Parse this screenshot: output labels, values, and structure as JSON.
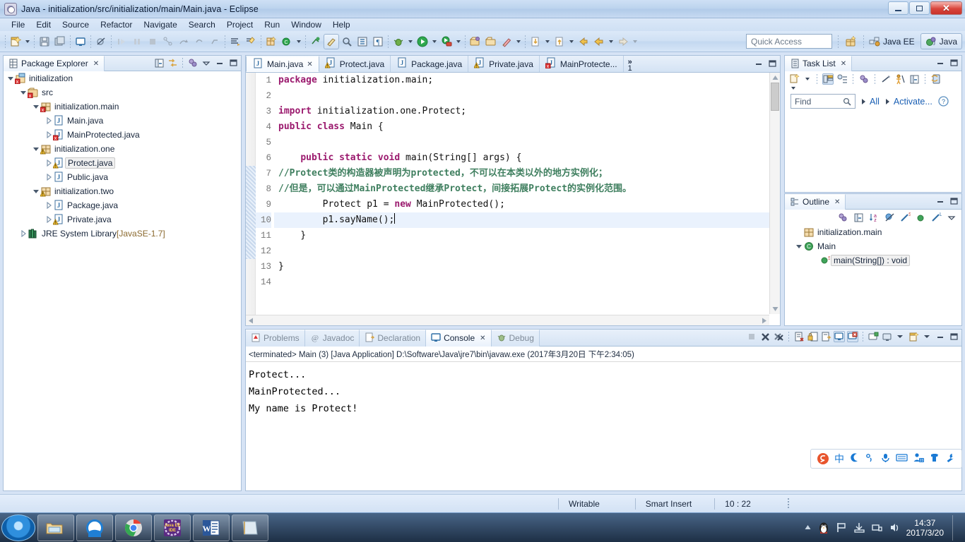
{
  "window": {
    "title": "Java - initialization/src/initialization/main/Main.java - Eclipse",
    "app_icon": "eclipse-icon",
    "minimize": "minimize-button",
    "maximize": "maximize-button",
    "close": "close-button"
  },
  "menubar": [
    "File",
    "Edit",
    "Source",
    "Refactor",
    "Navigate",
    "Search",
    "Project",
    "Run",
    "Window",
    "Help"
  ],
  "toolbar": {
    "quick_access_placeholder": "Quick Access",
    "perspectives": [
      {
        "label": "Java EE",
        "active": false
      },
      {
        "label": "Java",
        "active": true
      }
    ]
  },
  "package_explorer": {
    "title": "Package Explorer",
    "tree": [
      {
        "label": "initialization",
        "indent": 0,
        "arrow": "open",
        "icon": "project-icon",
        "error": true,
        "warn": false,
        "selected": false
      },
      {
        "label": "src",
        "indent": 1,
        "arrow": "open",
        "icon": "source-folder-icon",
        "error": true,
        "warn": false,
        "selected": false
      },
      {
        "label": "initialization.main",
        "indent": 2,
        "arrow": "open",
        "icon": "package-icon",
        "error": true,
        "warn": false,
        "selected": false
      },
      {
        "label": "Main.java",
        "indent": 3,
        "arrow": "closed",
        "icon": "java-file-icon",
        "error": false,
        "warn": false,
        "selected": false
      },
      {
        "label": "MainProtected.java",
        "indent": 3,
        "arrow": "closed",
        "icon": "java-file-icon",
        "error": true,
        "warn": false,
        "selected": false
      },
      {
        "label": "initialization.one",
        "indent": 2,
        "arrow": "open",
        "icon": "package-icon",
        "error": false,
        "warn": true,
        "selected": false
      },
      {
        "label": "Protect.java",
        "indent": 3,
        "arrow": "closed",
        "icon": "java-file-icon",
        "error": false,
        "warn": true,
        "selected": true
      },
      {
        "label": "Public.java",
        "indent": 3,
        "arrow": "closed",
        "icon": "java-file-icon",
        "error": false,
        "warn": false,
        "selected": false
      },
      {
        "label": "initialization.two",
        "indent": 2,
        "arrow": "open",
        "icon": "package-icon",
        "error": false,
        "warn": true,
        "selected": false
      },
      {
        "label": "Package.java",
        "indent": 3,
        "arrow": "closed",
        "icon": "java-file-icon",
        "error": false,
        "warn": false,
        "selected": false
      },
      {
        "label": "Private.java",
        "indent": 3,
        "arrow": "closed",
        "icon": "java-file-icon",
        "error": false,
        "warn": true,
        "selected": false
      },
      {
        "label": "JRE System Library",
        "suffix": " [JavaSE-1.7]",
        "indent": 1,
        "arrow": "closed",
        "icon": "jre-library-icon",
        "error": false,
        "warn": false,
        "selected": false
      }
    ]
  },
  "editor": {
    "tabs": [
      {
        "label": "Main.java",
        "icon": "java-file-icon",
        "active": true,
        "closeable": true,
        "warn": false,
        "error": false
      },
      {
        "label": "Protect.java",
        "icon": "java-file-icon",
        "active": false,
        "closeable": false,
        "warn": true,
        "error": false
      },
      {
        "label": "Package.java",
        "icon": "java-file-icon",
        "active": false,
        "closeable": false,
        "warn": false,
        "error": false
      },
      {
        "label": "Private.java",
        "icon": "java-file-icon",
        "active": false,
        "closeable": false,
        "warn": true,
        "error": false
      },
      {
        "label": "MainProtecte...",
        "icon": "java-file-icon",
        "active": false,
        "closeable": false,
        "warn": false,
        "error": true
      }
    ],
    "overflow_chevron": "»",
    "overflow_count": "1",
    "line_numbers": [
      "1",
      "2",
      "3",
      "4",
      "5",
      "6",
      "7",
      "8",
      "9",
      "10",
      "11",
      "12",
      "13",
      "14"
    ],
    "lines": [
      {
        "n": 1,
        "segs": [
          {
            "t": "package ",
            "c": "kw"
          },
          {
            "t": "initialization.main;",
            "c": "pl"
          }
        ]
      },
      {
        "n": 2,
        "segs": []
      },
      {
        "n": 3,
        "segs": [
          {
            "t": "import ",
            "c": "kw"
          },
          {
            "t": "initialization.one.Protect;",
            "c": "pl"
          }
        ]
      },
      {
        "n": 4,
        "segs": [
          {
            "t": "public class ",
            "c": "kw"
          },
          {
            "t": "Main {",
            "c": "pl"
          }
        ]
      },
      {
        "n": 5,
        "segs": []
      },
      {
        "n": 6,
        "segs": [
          {
            "t": "    ",
            "c": "pl"
          },
          {
            "t": "public static void ",
            "c": "kw"
          },
          {
            "t": "main(String[] args) {",
            "c": "pl"
          }
        ],
        "fold": true
      },
      {
        "n": 7,
        "segs": [
          {
            "t": "//Protect类的构造器被声明为protected，不可以在本类以外的地方实例化；",
            "c": "cm"
          }
        ]
      },
      {
        "n": 8,
        "segs": [
          {
            "t": "//但是，可以通过MainProtected继承Protect，间接拓展Protect的实例化范围。",
            "c": "cm"
          }
        ]
      },
      {
        "n": 9,
        "segs": [
          {
            "t": "        Protect p1 = ",
            "c": "pl"
          },
          {
            "t": "new ",
            "c": "kw"
          },
          {
            "t": "MainProtected();",
            "c": "pl"
          }
        ]
      },
      {
        "n": 10,
        "segs": [
          {
            "t": "        p1.sayName();",
            "c": "pl"
          }
        ],
        "highlight": true,
        "caret": true
      },
      {
        "n": 11,
        "segs": [
          {
            "t": "    }",
            "c": "pl"
          }
        ]
      },
      {
        "n": 12,
        "segs": []
      },
      {
        "n": 13,
        "segs": [
          {
            "t": "}",
            "c": "pl"
          }
        ]
      },
      {
        "n": 14,
        "segs": []
      }
    ]
  },
  "bottom_panel": {
    "tabs": [
      {
        "label": "Problems",
        "icon": "problems-icon",
        "active": false
      },
      {
        "label": "Javadoc",
        "icon": "javadoc-icon",
        "active": false
      },
      {
        "label": "Declaration",
        "icon": "declaration-icon",
        "active": false
      },
      {
        "label": "Console",
        "icon": "console-icon",
        "active": true
      },
      {
        "label": "Debug",
        "icon": "debug-icon",
        "active": false
      }
    ],
    "console_header": "<terminated> Main (3) [Java Application] D:\\Software\\Java\\jre7\\bin\\javaw.exe (2017年3月20日 下午2:34:05)",
    "console_output": [
      "Protect...",
      "MainProtected...",
      "My name is Protect!"
    ]
  },
  "task_list": {
    "title": "Task List",
    "find_placeholder": "Find",
    "filter_all": "All",
    "activate": "Activate...",
    "help_icon": "help-icon"
  },
  "outline": {
    "title": "Outline",
    "items": [
      {
        "label": "initialization.main",
        "icon": "package-icon",
        "indent": 0,
        "arrow": "none",
        "selected": false
      },
      {
        "label": "Main",
        "icon": "class-icon",
        "indent": 0,
        "arrow": "open",
        "selected": false
      },
      {
        "label": "main(String[]) : void",
        "icon": "method-icon",
        "indent": 1,
        "arrow": "none",
        "selected": true,
        "static_badge": "S"
      }
    ]
  },
  "status_bar": {
    "writable": "Writable",
    "insert_mode": "Smart Insert",
    "position": "10 : 22"
  },
  "taskbar": {
    "start": "start-button",
    "items": [
      "explorer-icon",
      "browser-icon",
      "chrome-icon",
      "eclipse-icon",
      "word-icon",
      "notepad-icon"
    ],
    "tray": [
      "show-hidden-icon",
      "qq-penguin-icon",
      "flag-icon",
      "action-center-icon",
      "network-icon",
      "volume-icon"
    ],
    "clock_time": "14:37",
    "clock_date": "2017/3/20"
  },
  "ime_bar": {
    "logo": "sogou-logo-icon",
    "items": [
      "中",
      "crescent-icon",
      "degree-icon",
      "microphone-icon",
      "keyboard-icon",
      "user-icon",
      "skin-icon",
      "tools-icon"
    ]
  },
  "colors": {
    "keyword": "#9b1a6e",
    "comment": "#3f7f5f",
    "chrome": "#cfe0f4",
    "accent": "#1a7ad4"
  }
}
